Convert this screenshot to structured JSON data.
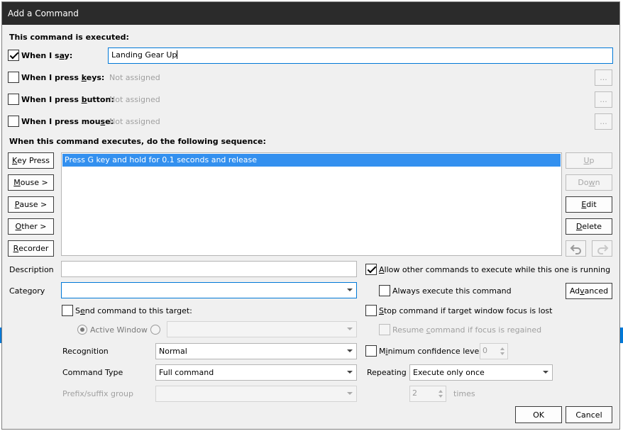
{
  "window": {
    "title": "Add a Command"
  },
  "executed": {
    "heading": "This command is executed:",
    "when_say": {
      "label_pre": "When I s",
      "label_u": "a",
      "label_post": "y:",
      "checked": true,
      "value": "Landing Gear Up"
    },
    "when_keys": {
      "label_pre": "When I press ",
      "label_u": "k",
      "label_post": "eys:",
      "checked": false,
      "value": "Not assigned",
      "browse": "..."
    },
    "when_button": {
      "label_pre": "When I press ",
      "label_u": "b",
      "label_post": "utton:",
      "checked": false,
      "value": "Not assigned",
      "browse": "..."
    },
    "when_mouse": {
      "label_pre": "When I press mou",
      "label_u": "s",
      "label_post": "e:",
      "checked": false,
      "value": "Not assigned",
      "browse": "..."
    }
  },
  "sequence": {
    "heading": "When this command executes, do the following sequence:",
    "items": [
      "Press G key and hold for 0.1 seconds and release"
    ],
    "left_buttons": {
      "key_press": {
        "u": "K",
        "rest": "ey Press"
      },
      "mouse": {
        "u": "M",
        "rest": "ouse >"
      },
      "pause": {
        "u": "P",
        "rest": "ause >"
      },
      "other": {
        "u": "O",
        "rest": "ther >"
      },
      "recorder": {
        "u": "R",
        "rest": "ecorder"
      }
    },
    "right_buttons": {
      "up": {
        "u": "U",
        "rest": "p"
      },
      "down": {
        "pre": "Do",
        "u": "w",
        "rest": "n"
      },
      "edit": {
        "u": "E",
        "rest": "dit"
      },
      "delete": {
        "u": "D",
        "rest": "elete"
      }
    },
    "icons": {
      "undo": "undo-icon",
      "redo": "redo-icon"
    }
  },
  "details": {
    "description_label": "Description",
    "description_value": "",
    "category_label": "Category",
    "category_value": "",
    "send_target": {
      "pre": "S",
      "u": "e",
      "rest": "nd command to this target:",
      "checked": false
    },
    "active_window": {
      "label": "Active Window",
      "selected": true
    },
    "target_value": "",
    "recognition_label": "Recognition",
    "recognition_value": "Normal",
    "command_type_label": "Command Type",
    "command_type_value": "Full command",
    "prefix_label": "Prefix/suffix group",
    "prefix_value": ""
  },
  "options": {
    "allow_other": {
      "pre": "",
      "u": "A",
      "rest": "llow other commands to execute while this one is running",
      "checked": true
    },
    "always_execute": {
      "label": "Always execute this command",
      "checked": false
    },
    "advanced": {
      "pre": "Ad",
      "u": "v",
      "rest": "anced"
    },
    "stop_focus": {
      "pre": "",
      "u": "S",
      "rest": "top command if target window focus is lost",
      "checked": false
    },
    "resume_focus": {
      "pre": "Resume ",
      "u": "c",
      "rest": "ommand if focus is regained",
      "checked": false
    },
    "min_conf": {
      "pre": "M",
      "u": "i",
      "rest": "nimum confidence level",
      "checked": false,
      "value": "0"
    },
    "repeating_label": "Repeating",
    "repeating_value": "Execute only once",
    "times_value": "2",
    "times_label": "times"
  },
  "footer": {
    "ok": "OK",
    "cancel": "Cancel"
  },
  "colors": {
    "titlebar": "#2b2b2b",
    "selection": "#3390ef",
    "focus": "#0078d7",
    "dialog": "#f0f0f0"
  }
}
